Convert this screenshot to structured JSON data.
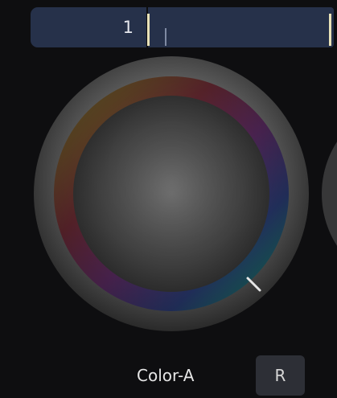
{
  "value_field": {
    "value": "1"
  },
  "color_wheel": {
    "label": "Color-A",
    "reset_label": "R"
  },
  "colors": {
    "background": "#0e0e10",
    "field": "#26314a",
    "cursor": "#e9e2b8",
    "button": "#2d2f36"
  }
}
